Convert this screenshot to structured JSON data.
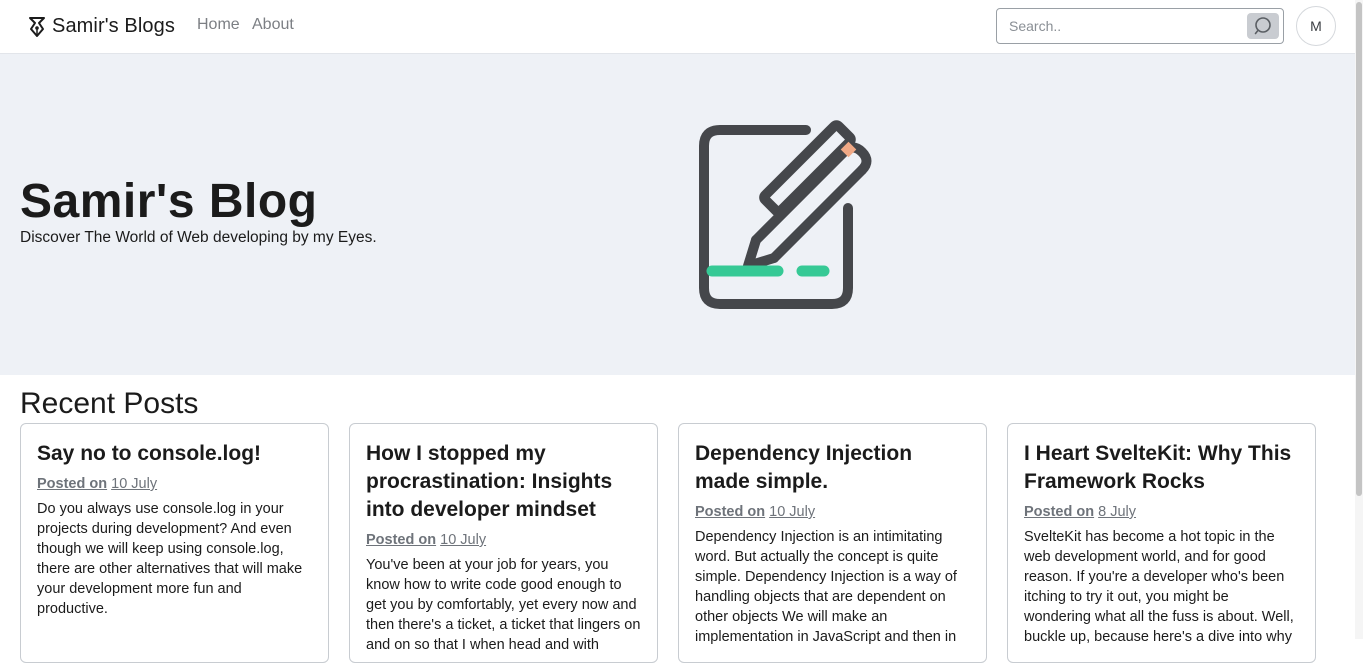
{
  "navbar": {
    "brand": "Samir's Blogs",
    "links": [
      {
        "label": "Home"
      },
      {
        "label": "About"
      }
    ],
    "search_placeholder": "Search..",
    "avatar_initial": "M"
  },
  "hero": {
    "title": "Samir's Blog",
    "subtitle": "Discover The World of Web developing by my Eyes."
  },
  "recent": {
    "heading": "Recent Posts",
    "posted_label": "Posted on",
    "posts": [
      {
        "title": "Say no to console.log!",
        "date": "10 July",
        "excerpt": "Do you always use console.log in your projects during development? And even though we will keep using console.log, there are other alternatives that will make your development more fun and productive."
      },
      {
        "title": "How I stopped my procrastination: Insights into developer mindset",
        "date": "10 July",
        "excerpt": "You've been at your job for years, you know how to write code good enough to get you by comfortably, yet every now and then there's a ticket, a ticket that lingers on and on so that I when head and with"
      },
      {
        "title": "Dependency Injection made simple.",
        "date": "10 July",
        "excerpt": "Dependency Injection is an intimitating word. But actually the concept is quite simple. Dependency Injection is a way of handling objects that are dependent on other objects We will make an implementation in JavaScript and then in"
      },
      {
        "title": "I Heart SvelteKit: Why This Framework Rocks",
        "date": "8 July",
        "excerpt": "SvelteKit has become a hot topic in the web development world, and for good reason. If you're a developer who's been itching to try it out, you might be wondering what all the fuss is about. Well, buckle up, because here's a dive into why"
      }
    ]
  },
  "colors": {
    "hero_bg": "#eef1f6",
    "illustration_stroke": "#45474b",
    "illustration_accent": "#36c995",
    "pencil_tip": "#f0a986"
  },
  "icons": {
    "brand": "pen-nib-icon",
    "search": "search-icon"
  }
}
